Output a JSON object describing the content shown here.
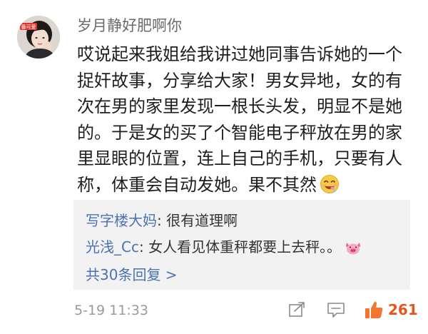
{
  "comment": {
    "username": "岁月静好肥啊你",
    "avatar_text": "番可爱",
    "text_lines": [
      "哎说起来我姐给我讲过她同事告诉她的一个",
      "捉奸故事，分享给大家！男女异地，女的有",
      "次在男的家里发现一根长头发，明显不是她",
      "的。于是女的买了个智能电子秤放在男的家",
      "里显眼的位置，连上自己的手机，只要有人",
      "称，体重会自动发她。果不其然"
    ],
    "inline_emoji": "drooling-face-icon",
    "replies": [
      {
        "author": "写字楼大妈",
        "separator": ": ",
        "text": "很有道理啊"
      },
      {
        "author": "光浅_Cc",
        "separator": ": ",
        "text": "女人看见体重秤都要上去秤。。",
        "emoji": "pig-face-icon"
      }
    ],
    "more_replies_label": "共30条回复 >",
    "timestamp": "5-19 11:33",
    "like_count": "261"
  },
  "colors": {
    "link_blue": "#4a72b3",
    "like_orange": "#e8541e",
    "reply_bg": "#f2f2f2",
    "meta_gray": "#9a9a9a"
  }
}
